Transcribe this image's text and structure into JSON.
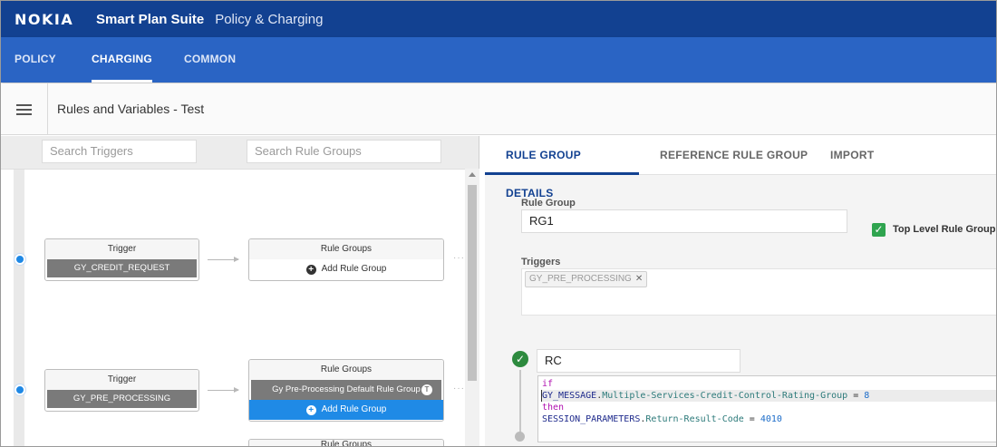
{
  "app": {
    "brand": "NOKIA",
    "suite": "Smart Plan Suite",
    "subtitle": "Policy & Charging"
  },
  "nav": {
    "tabs": [
      {
        "label": "POLICY",
        "active": false
      },
      {
        "label": "CHARGING",
        "active": true
      },
      {
        "label": "COMMON",
        "active": false
      }
    ]
  },
  "page": {
    "title": "Rules and Variables - Test"
  },
  "left": {
    "search_triggers_placeholder": "Search Triggers",
    "search_rule_groups_placeholder": "Search Rule Groups",
    "rows": [
      {
        "trigger_header": "Trigger",
        "trigger_name": "GY_CREDIT_REQUEST",
        "groups_header": "Rule Groups",
        "groups": [],
        "add_label": "Add Rule Group"
      },
      {
        "trigger_header": "Trigger",
        "trigger_name": "GY_PRE_PROCESSING",
        "groups_header": "Rule Groups",
        "groups": [
          "Gy Pre-Processing Default Rule Group"
        ],
        "add_label": "Add Rule Group"
      }
    ],
    "third_card_header": "Rule Groups"
  },
  "right": {
    "tabs": [
      {
        "label": "RULE GROUP DETAILS",
        "active": true
      },
      {
        "label": "REFERENCE RULE GROUP",
        "active": false
      },
      {
        "label": "IMPORT",
        "active": false
      }
    ],
    "rule_group_label": "Rule Group",
    "rule_group_value": "RG1",
    "top_level_label": "Top Level Rule Group",
    "top_level_checked": true,
    "triggers_label": "Triggers",
    "trigger_chip": "GY_PRE_PROCESSING",
    "rule_name": "RC",
    "code": {
      "if": "if",
      "cond_obj": "GY_MESSAGE",
      "cond_dot": ".",
      "cond_prop": "Multiple-Services-Credit-Control-Rating-Group",
      "cond_op": " = ",
      "cond_val": "8",
      "then": "then",
      "act_obj": "SESSION_PARAMETERS",
      "act_dot": ".",
      "act_prop": "Return-Result-Code",
      "act_op": " = ",
      "act_val": "4010"
    }
  },
  "colors": {
    "topbar": "#124191",
    "nav": "#2a64c4",
    "accent_blue": "#1f8ae6",
    "check_green": "#2fa44f"
  }
}
